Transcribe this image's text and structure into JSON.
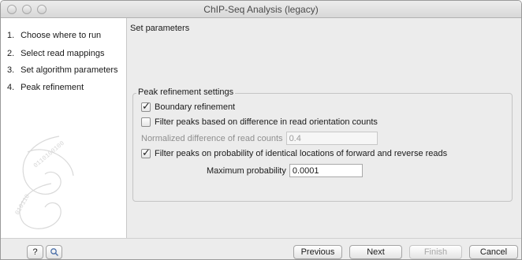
{
  "window": {
    "title": "ChIP-Seq Analysis (legacy)"
  },
  "steps": [
    {
      "number": "1.",
      "label": "Choose where to run"
    },
    {
      "number": "2.",
      "label": "Select read mappings"
    },
    {
      "number": "3.",
      "label": "Set algorithm parameters"
    },
    {
      "number": "4.",
      "label": "Peak refinement"
    }
  ],
  "main": {
    "heading": "Set parameters",
    "group_title": "Peak refinement settings",
    "boundary_refinement": {
      "label": "Boundary refinement",
      "checked": true
    },
    "filter_orientation": {
      "label": "Filter peaks based on difference in read orientation counts",
      "checked": false
    },
    "normalized_difference": {
      "label": "Normalized difference of read counts",
      "value": "0.4",
      "enabled": false
    },
    "filter_probability": {
      "label": "Filter peaks on probability of identical locations of forward and reverse reads",
      "checked": true
    },
    "max_probability": {
      "label": "Maximum probability",
      "value": "0.0001"
    }
  },
  "buttons": {
    "help": "?",
    "previous": "Previous",
    "next": "Next",
    "finish": "Finish",
    "cancel": "Cancel"
  },
  "icons": {
    "help": "question-mark-icon",
    "search": "magnifier-icon",
    "decoration": "clc-spiral-logo"
  }
}
